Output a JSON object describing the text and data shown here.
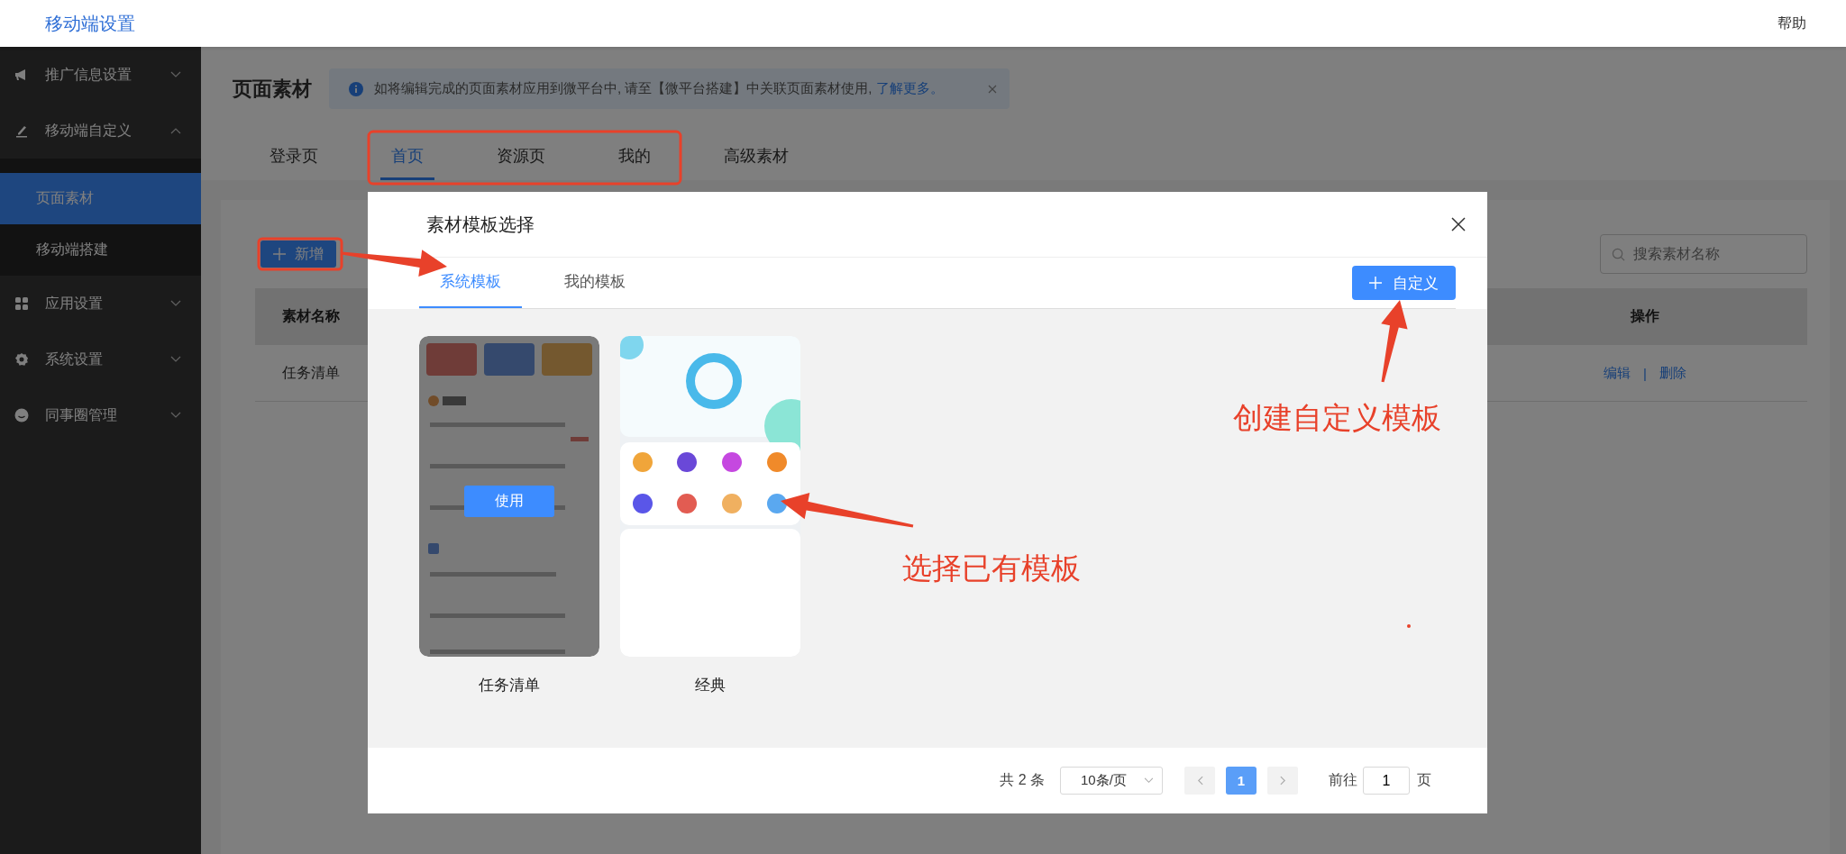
{
  "top_bar": {
    "title": "移动端设置",
    "help": "帮助"
  },
  "sidebar": {
    "items": [
      {
        "label": "推广信息设置",
        "expanded": false
      },
      {
        "label": "移动端自定义",
        "expanded": true,
        "children": [
          {
            "label": "页面素材",
            "selected": true
          },
          {
            "label": "移动端搭建",
            "selected": false
          }
        ]
      },
      {
        "label": "应用设置",
        "expanded": false
      },
      {
        "label": "系统设置",
        "expanded": false
      },
      {
        "label": "同事圈管理",
        "expanded": false
      }
    ]
  },
  "page": {
    "title": "页面素材",
    "alert": {
      "text": "如将编辑完成的页面素材应用到微平台中, 请至【微平台搭建】中关联页面素材使用, ",
      "link": "了解更多。"
    },
    "tabs": [
      {
        "label": "登录页",
        "selected": false
      },
      {
        "label": "首页",
        "selected": true
      },
      {
        "label": "资源页",
        "selected": false
      },
      {
        "label": "我的",
        "selected": false
      },
      {
        "label": "高级素材",
        "selected": false
      }
    ],
    "add_button": "新增",
    "search": {
      "placeholder": "搜索素材名称"
    },
    "table": {
      "columns": [
        "素材名称",
        "操作"
      ],
      "rows": [
        {
          "name": "任务清单",
          "actions": [
            "编辑",
            "删除"
          ],
          "separator": "|"
        }
      ]
    }
  },
  "modal": {
    "title": "素材模板选择",
    "tabs": [
      {
        "label": "系统模板",
        "selected": true
      },
      {
        "label": "我的模板",
        "selected": false
      }
    ],
    "custom_button": "自定义",
    "use_button": "使用",
    "templates": [
      {
        "name": "任务清单",
        "hovered": true,
        "kind": "picture"
      },
      {
        "name": "经典",
        "hovered": false,
        "kind": "picture"
      }
    ],
    "pagination": {
      "total": "共 2 条",
      "page_size": "10条/页",
      "pages": [
        {
          "label": "1",
          "selected": true
        }
      ],
      "goto_label": "前往",
      "goto_value": "1",
      "goto_suffix": "页"
    }
  },
  "annotations": [
    "创建自定义模板",
    "选择已有模板"
  ]
}
